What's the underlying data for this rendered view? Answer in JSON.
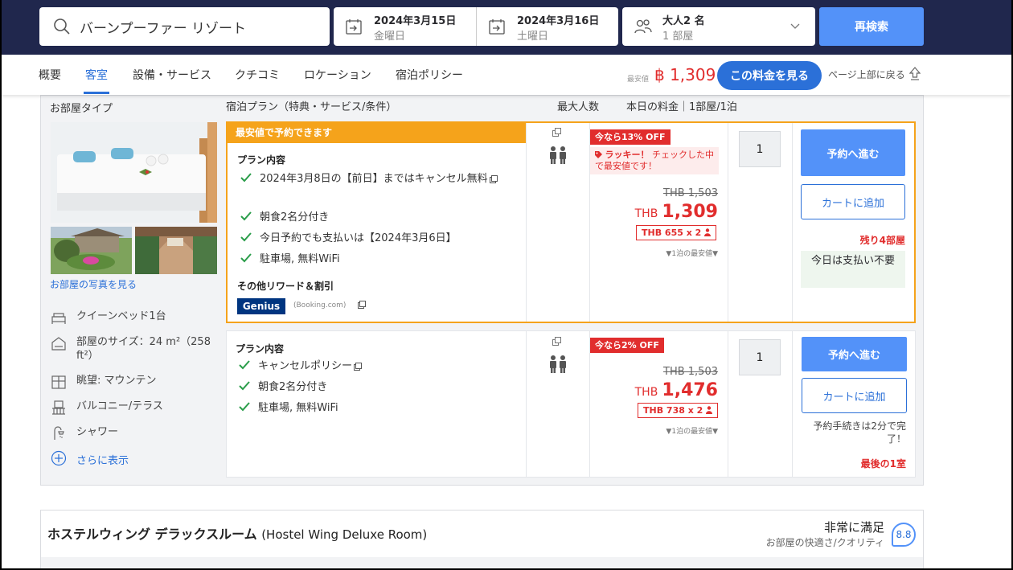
{
  "search": {
    "destination": "バーンプーファー リゾート",
    "checkin_date": "2024年3月15日",
    "checkin_day": "金曜日",
    "checkout_date": "2024年3月16日",
    "checkout_day": "土曜日",
    "guests": "大人2 名",
    "rooms": "1 部屋",
    "search_button": "再検索"
  },
  "nav": {
    "tabs": [
      "概要",
      "客室",
      "設備・サービス",
      "クチコミ",
      "ロケーション",
      "宿泊ポリシー"
    ],
    "active_tab": "客室",
    "lowest_label": "最安値",
    "lowest_price": "฿ 1,309",
    "see_rate_button": "この料金を見る",
    "back_to_top": "ページ上部に戻る"
  },
  "room": {
    "type_title": "お部屋タイプ",
    "photos_link": "お部屋の写真を見る",
    "features": [
      {
        "icon": "bed-icon",
        "label": "クイーンベッド1台"
      },
      {
        "icon": "house-size-icon",
        "label": "部屋のサイズ：24 m²（258 ft²）"
      },
      {
        "icon": "window-view-icon",
        "label": "眺望: マウンテン"
      },
      {
        "icon": "balcony-icon",
        "label": "バルコニー/テラス"
      },
      {
        "icon": "shower-icon",
        "label": "シャワー"
      }
    ],
    "show_more": "さらに表示",
    "headers": {
      "plan": "宿泊プラン（特典・サービス/条件）",
      "max_guests": "最大人数",
      "todays_rate": "本日の料金｜1部屋/1泊"
    }
  },
  "offers": [
    {
      "ribbon": "最安値で予約できます",
      "plan_title": "プラン内容",
      "items": [
        "2024年3月8日の【前日】まではキャンセル無料",
        "朝食2名分付き",
        "今日予約でも支払いは【2024年3月6日】",
        "駐車場, 無料WiFi"
      ],
      "rewards_title": "その他リワード＆割引",
      "genius_label": "Genius",
      "genius_source": "(Booking.com)",
      "discount": "今なら13% OFF",
      "lucky_bold": "ラッキー！",
      "lucky_text": "チェックした中で最安値です！",
      "original_price": "THB 1,503",
      "currency": "THB",
      "price": "1,309",
      "per_person": "THB 655 x 2",
      "nightly_note": "▼1泊の最安値▼",
      "quantity": "1",
      "book_button": "予約へ進む",
      "cart_button": "カートに追加",
      "rooms_left": "残り4部屋",
      "pay_note": "今日は支払い不要"
    },
    {
      "plan_title": "プラン内容",
      "items": [
        "キャンセルポリシー",
        "朝食2名分付き",
        "駐車場, 無料WiFi"
      ],
      "discount": "今なら2% OFF",
      "original_price": "THB 1,503",
      "currency": "THB",
      "price": "1,476",
      "per_person": "THB 738 x 2",
      "nightly_note": "▼1泊の最安値▼",
      "quantity": "1",
      "book_button": "予約へ進む",
      "cart_button": "カートに追加",
      "quick_note": "予約手続きは2分で完了！",
      "rooms_left": "最後の1室"
    }
  ],
  "next_room": {
    "title_ja": "ホステルウィング デラックスルーム",
    "title_en": "(Hostel Wing Deluxe Room)",
    "review_word": "非常に満足",
    "review_sub": "お部屋の快適さ/クオリティ",
    "score": "8.8"
  },
  "colors": {
    "header_bg": "#20274d",
    "primary_blue": "#5392f9",
    "link_blue": "#2b70d8",
    "price_red": "#e12d2d",
    "ribbon_orange": "#f5a31b"
  }
}
